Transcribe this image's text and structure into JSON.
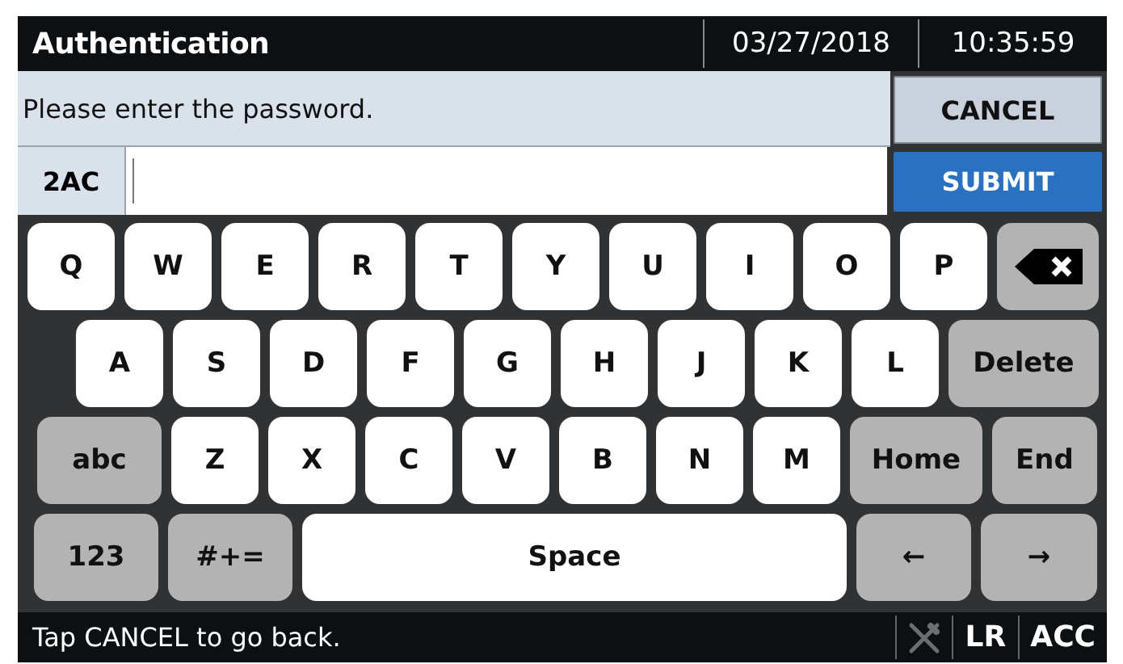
{
  "title_bar": {
    "title": "Authentication",
    "date": "03/27/2018",
    "time": "10:35:59"
  },
  "prompt": {
    "message": "Please enter the password.",
    "cancel": "CANCEL"
  },
  "password_field": {
    "prefix": "2AC",
    "submit": "SUBMIT"
  },
  "keyboard": {
    "rows": [
      {
        "keys": [
          {
            "kind": "char",
            "label": "Q"
          },
          {
            "kind": "char",
            "label": "W"
          },
          {
            "kind": "char",
            "label": "E"
          },
          {
            "kind": "char",
            "label": "R"
          },
          {
            "kind": "char",
            "label": "T"
          },
          {
            "kind": "char",
            "label": "Y"
          },
          {
            "kind": "char",
            "label": "U"
          },
          {
            "kind": "char",
            "label": "I"
          },
          {
            "kind": "char",
            "label": "O"
          },
          {
            "kind": "char",
            "label": "P"
          },
          {
            "kind": "backspace"
          }
        ]
      },
      {
        "keys": [
          {
            "kind": "char",
            "label": "A"
          },
          {
            "kind": "char",
            "label": "S"
          },
          {
            "kind": "char",
            "label": "D"
          },
          {
            "kind": "char",
            "label": "F"
          },
          {
            "kind": "char",
            "label": "G"
          },
          {
            "kind": "char",
            "label": "H"
          },
          {
            "kind": "char",
            "label": "J"
          },
          {
            "kind": "char",
            "label": "K"
          },
          {
            "kind": "char",
            "label": "L"
          },
          {
            "kind": "function",
            "label": "Delete"
          }
        ]
      },
      {
        "keys": [
          {
            "kind": "function",
            "label": "abc"
          },
          {
            "kind": "char",
            "label": "Z"
          },
          {
            "kind": "char",
            "label": "X"
          },
          {
            "kind": "char",
            "label": "C"
          },
          {
            "kind": "char",
            "label": "V"
          },
          {
            "kind": "char",
            "label": "B"
          },
          {
            "kind": "char",
            "label": "N"
          },
          {
            "kind": "char",
            "label": "M"
          },
          {
            "kind": "function",
            "label": "Home"
          },
          {
            "kind": "function",
            "label": "End"
          }
        ]
      },
      {
        "keys": [
          {
            "kind": "function",
            "label": "123"
          },
          {
            "kind": "function",
            "label": "#+="
          },
          {
            "kind": "char",
            "label": "Space"
          },
          {
            "kind": "function",
            "label": "←"
          },
          {
            "kind": "function",
            "label": "→"
          }
        ]
      }
    ]
  },
  "status_bar": {
    "hint": "Tap CANCEL to go back.",
    "indicators": [
      "LR",
      "ACC"
    ]
  }
}
